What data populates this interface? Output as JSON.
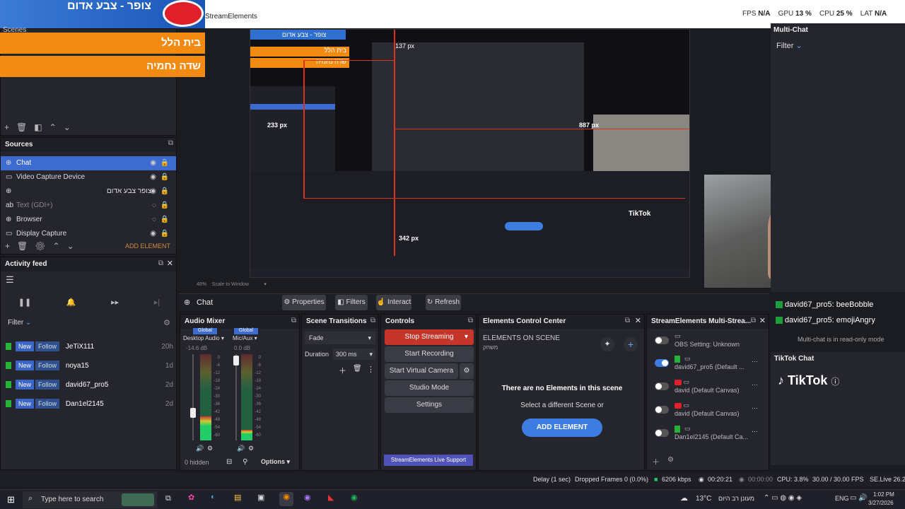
{
  "top": {
    "banner_text": "צופר - צבע אדום",
    "streamelements_label": "StreamElements",
    "stats": {
      "fps_label": "FPS",
      "fps_value": "N/A",
      "gpu_label": "GPU",
      "gpu_value": "13 %",
      "cpu_label": "CPU",
      "cpu_value": "25 %",
      "lat_label": "LAT",
      "lat_value": "N/A"
    }
  },
  "scenes": {
    "title": "Scenes",
    "items": [
      "בית הלל",
      "שדה נחמיה"
    ]
  },
  "sources": {
    "title": "Sources",
    "items": [
      {
        "label": "Chat",
        "icon": "globe-icon"
      },
      {
        "label": "Video Capture Device",
        "icon": "camera-icon"
      },
      {
        "label": "צופר צבע אדום",
        "icon": "globe-icon"
      },
      {
        "label": "Text (GDI+)",
        "icon": "text-icon"
      },
      {
        "label": "Browser",
        "icon": "globe-icon"
      },
      {
        "label": "Display Capture",
        "icon": "monitor-icon"
      }
    ],
    "add_element": "ADD ELEMENT"
  },
  "activity_feed": {
    "title": "Activity feed",
    "filter": "Filter",
    "rows": [
      {
        "new": "New",
        "follow": "Follow",
        "name": "JeTiX111",
        "age": "20h"
      },
      {
        "new": "New",
        "follow": "Follow",
        "name": "noya15",
        "age": "1d"
      },
      {
        "new": "New",
        "follow": "Follow",
        "name": "david67_pro5",
        "age": "2d"
      },
      {
        "new": "New",
        "follow": "Follow",
        "name": "Dan1el2145",
        "age": "2d"
      }
    ]
  },
  "preview": {
    "measure_1": "137 px",
    "measure_2": "233 px",
    "measure_3": "887 px",
    "measure_4": "342 px",
    "tiktok": "TikTok",
    "zoom": "48%",
    "scale_mode": "Scale to Window"
  },
  "context_bar": {
    "source_name": "Chat",
    "properties": "Properties",
    "filters": "Filters",
    "interact": "Interact",
    "refresh": "Refresh"
  },
  "audio_mixer": {
    "title": "Audio Mixer",
    "ch1": {
      "scope": "Global",
      "name": "Desktop Audio",
      "db": "-14.6 dB"
    },
    "ch2": {
      "scope": "Global",
      "name": "Mic/Aux",
      "db": "0.0 dB"
    },
    "scale": [
      "0",
      "-6",
      "-12",
      "-18",
      "-24",
      "-30",
      "-36",
      "-42",
      "-48",
      "-54",
      "-60"
    ],
    "hidden": "0 hidden",
    "options": "Options",
    "level_1": 0.28,
    "level_2": 0.12
  },
  "scene_transitions": {
    "title": "Scene Transitions",
    "transition": "Fade",
    "duration_label": "Duration",
    "duration_value": "300 ms"
  },
  "controls": {
    "title": "Controls",
    "stop_streaming": "Stop Streaming",
    "start_recording": "Start Recording",
    "start_virtual_camera": "Start Virtual Camera",
    "studio_mode": "Studio Mode",
    "settings": "Settings",
    "support": "StreamElements Live Support"
  },
  "elements_center": {
    "title": "Elements Control Center",
    "on_scene": "ELEMENTS ON SCENE",
    "sub": "משחק",
    "empty_title": "There are no Elements in this scene",
    "empty_sub": "Select a different Scene or",
    "add_button": "ADD ELEMENT"
  },
  "multistream": {
    "title": "StreamElements Multi-Strea...",
    "rows": [
      {
        "label": "OBS Setting: Unknown",
        "on": false
      },
      {
        "label": "david67_pro5 (Default ...",
        "on": true
      },
      {
        "label": "david (Default Canvas)",
        "on": false
      },
      {
        "label": "david (Default Canvas)",
        "on": false
      },
      {
        "label": "Dan1el2145 (Default Ca...",
        "on": false
      }
    ]
  },
  "multichat": {
    "title": "Multi-Chat",
    "filter": "Filter",
    "messages": [
      {
        "user": "david67_pro5:",
        "text": "beeBobble"
      },
      {
        "user": "david67_pro5:",
        "text": "emojiAngry"
      }
    ],
    "readonly": "Multi-chat is in read-only mode"
  },
  "tiktok_chat": {
    "title": "TikTok Chat",
    "logo": "TikTok"
  },
  "status": {
    "delay": "Delay (1 sec)",
    "dropped": "Dropped Frames 0 (0.0%)",
    "kbps": "6206 kbps",
    "live_time": "00:20:21",
    "rec_time": "00:00:00",
    "cpu": "CPU: 3.8%",
    "fps": "30.00 / 30.00 FPS",
    "version": "SE.Live 26.2"
  },
  "taskbar": {
    "search": "Type here to search",
    "weather": "13°C",
    "weather_text": "מעונן רב היום",
    "lang": "ENG",
    "time": "1:02 PM",
    "date": "3/27/2026"
  }
}
